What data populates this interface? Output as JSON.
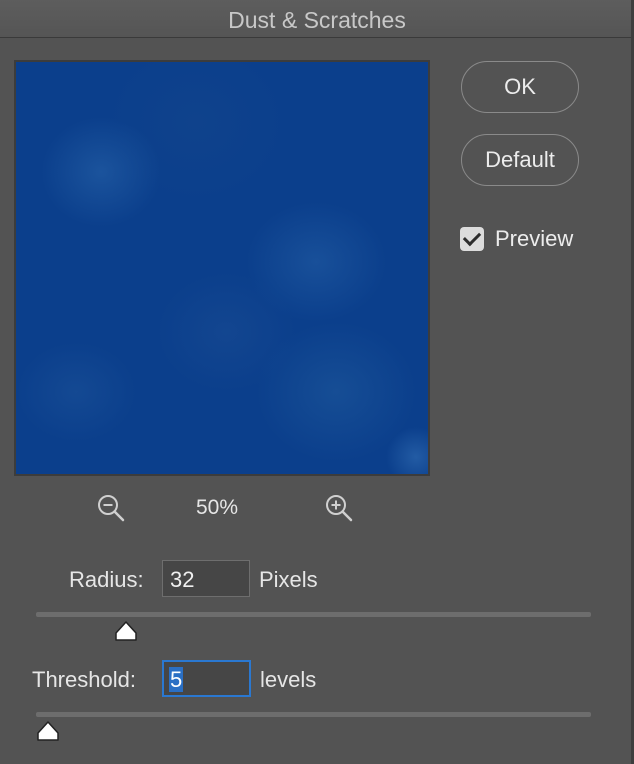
{
  "window": {
    "title": "Dust & Scratches"
  },
  "buttons": {
    "ok": "OK",
    "default": "Default"
  },
  "preview_toggle": {
    "label": "Preview",
    "checked": true
  },
  "zoom": {
    "level": "50%",
    "zoom_out_icon": "zoom-out-magnifier",
    "zoom_in_icon": "zoom-in-magnifier"
  },
  "radius": {
    "label": "Radius:",
    "value": "32",
    "unit": "Pixels"
  },
  "threshold": {
    "label": "Threshold:",
    "value": "5",
    "unit": "levels"
  },
  "colors": {
    "background": "#535353",
    "preview_blue": "#0b3f8c",
    "focus_ring": "#2a78d1"
  }
}
